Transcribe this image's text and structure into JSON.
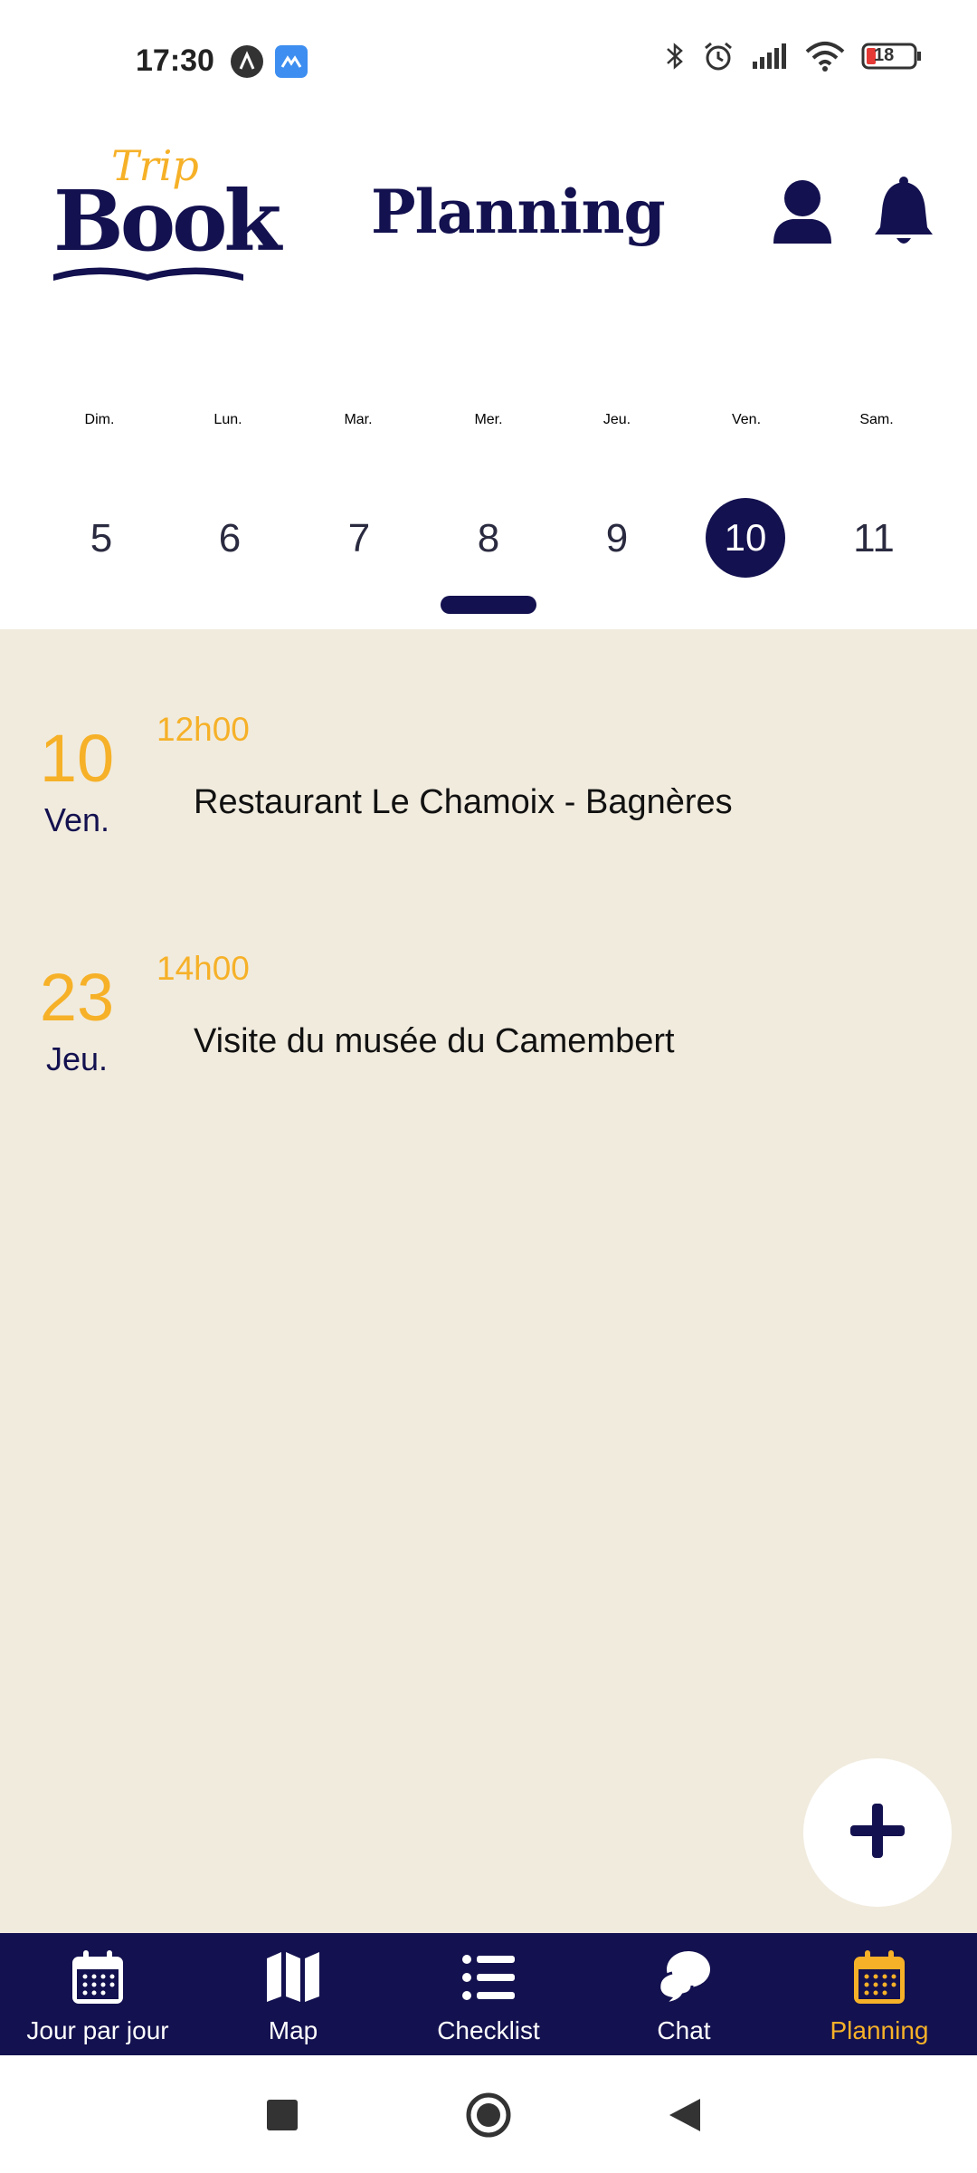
{
  "status_bar": {
    "time": "17:30",
    "battery": "18",
    "icons": [
      "app-a-icon",
      "app-mail-icon",
      "bluetooth-icon",
      "alarm-icon",
      "signal-icon",
      "wifi-icon",
      "battery-icon"
    ]
  },
  "header": {
    "logo_top": "Trip",
    "logo_main": "Book",
    "title": "Planning",
    "icons": [
      "user-icon",
      "bell-icon"
    ]
  },
  "week": {
    "days": [
      {
        "name": "Dim.",
        "num": "5"
      },
      {
        "name": "Lun.",
        "num": "6"
      },
      {
        "name": "Mar.",
        "num": "7"
      },
      {
        "name": "Mer.",
        "num": "8"
      },
      {
        "name": "Jeu.",
        "num": "9"
      },
      {
        "name": "Ven.",
        "num": "10"
      },
      {
        "name": "Sam.",
        "num": "11"
      }
    ],
    "selected_day": "10"
  },
  "events": [
    {
      "day_num": "10",
      "day_name": "Ven.",
      "time": "12h00",
      "title": "Restaurant Le Chamoix - Bagnères"
    },
    {
      "day_num": "23",
      "day_name": "Jeu.",
      "time": "14h00",
      "title": "Visite du musée du Camembert"
    }
  ],
  "fab": {
    "icon": "plus-icon"
  },
  "bottom_nav": {
    "items": [
      {
        "label": "Jour par jour",
        "icon": "calendar-icon"
      },
      {
        "label": "Map",
        "icon": "map-icon"
      },
      {
        "label": "Checklist",
        "icon": "list-icon"
      },
      {
        "label": "Chat",
        "icon": "chat-icon"
      },
      {
        "label": "Planning",
        "icon": "calendar-icon"
      }
    ],
    "active": "Planning"
  },
  "colors": {
    "navy": "#13114f",
    "accent": "#f6b128",
    "background_events": "#f1ebde"
  }
}
